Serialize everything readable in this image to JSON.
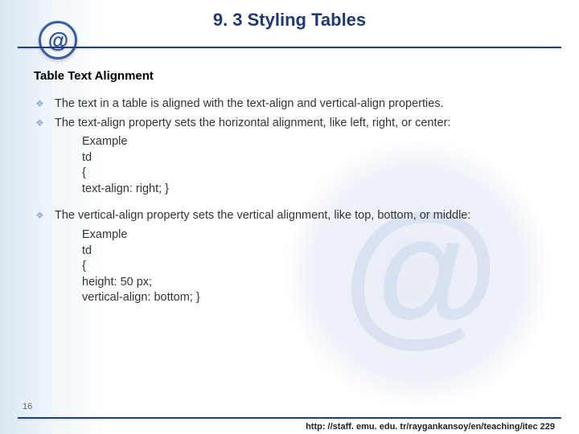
{
  "title": "9. 3 Styling Tables",
  "logo_glyph": "@",
  "subheading": "Table Text Alignment",
  "bullet1": "The text in a table is aligned with the text-align and vertical-align properties.",
  "bullet2": "The text-align property sets the horizontal alignment, like left, right, or center:",
  "example1": {
    "l1": "Example",
    "l2": "td",
    "l3": "{",
    "l4": "text-align: right; }"
  },
  "bullet3": "The vertical-align property sets the vertical alignment, like top, bottom, or middle:",
  "example2": {
    "l1": "Example",
    "l2": "td",
    "l3": "{",
    "l4": "height: 50 px;",
    "l5": "vertical-align: bottom; }"
  },
  "slide_number": "16",
  "footer_url": "http: //staff. emu. edu. tr/raygankansoy/en/teaching/itec 229"
}
